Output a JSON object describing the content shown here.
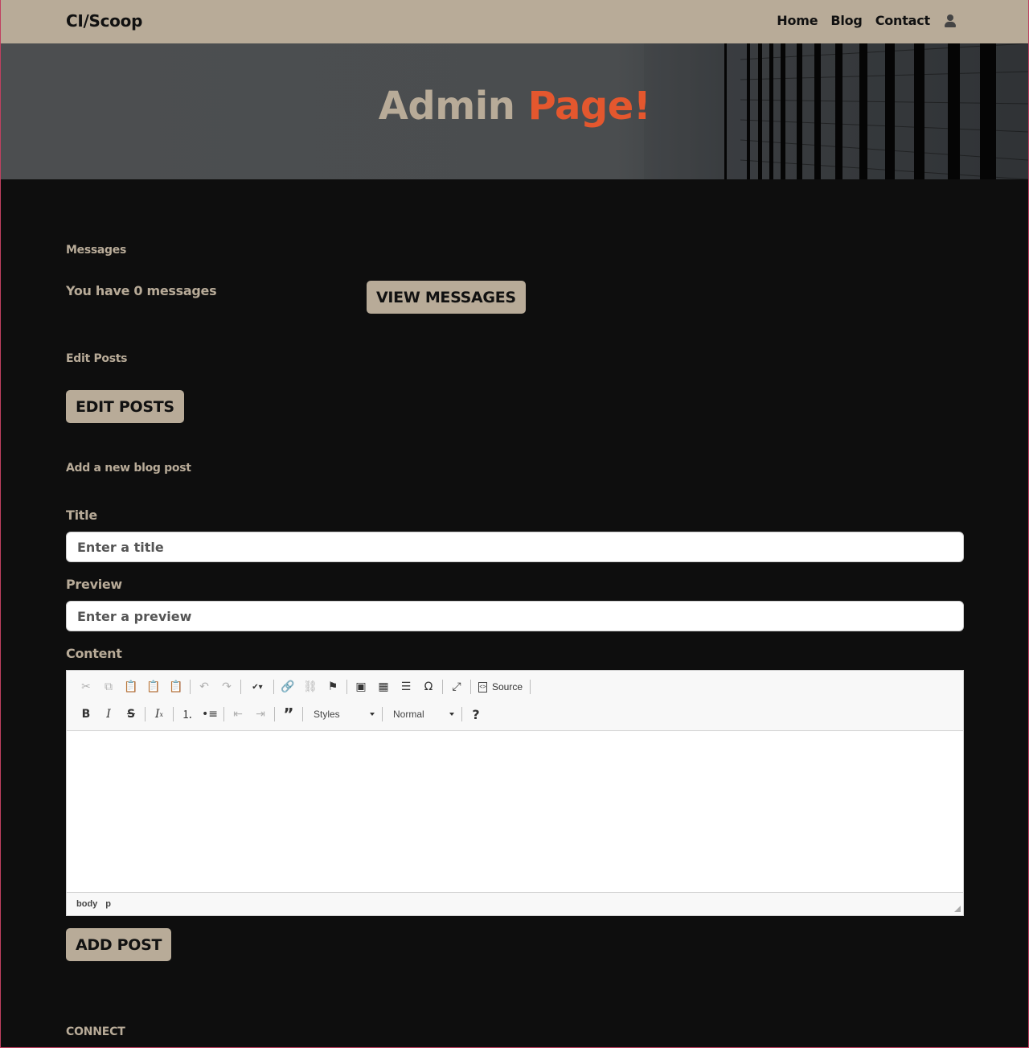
{
  "navbar": {
    "brand": "CI/Scoop",
    "links": [
      "Home",
      "Blog",
      "Contact"
    ],
    "user_icon": "user-icon"
  },
  "hero": {
    "title_part1": "Admin",
    "title_part2": "Page!"
  },
  "messages": {
    "section_label": "Messages",
    "count_text": "You have 0 messages",
    "view_button": "VIEW MESSAGES"
  },
  "edit_posts": {
    "section_label": "Edit Posts",
    "button": "EDIT POSTS"
  },
  "new_post": {
    "section_label": "Add a new blog post",
    "title_label": "Title",
    "title_placeholder": "Enter a title",
    "title_value": "",
    "preview_label": "Preview",
    "preview_placeholder": "Enter a preview",
    "preview_value": "",
    "content_label": "Content",
    "submit_button": "ADD POST"
  },
  "editor": {
    "toolbar_row1": [
      "cut-icon",
      "copy-icon",
      "paste-icon",
      "paste-text-icon",
      "paste-word-icon",
      "undo-icon",
      "redo-icon",
      "spellcheck-icon",
      "link-icon",
      "unlink-icon",
      "anchor-icon",
      "image-icon",
      "table-icon",
      "horizontal-rule-icon",
      "special-char-icon",
      "maximize-icon"
    ],
    "source_label": "Source",
    "styles_label": "Styles",
    "format_label": "Normal",
    "path": [
      "body",
      "p"
    ]
  },
  "footer": {
    "connect_label": "CONNECT"
  },
  "colors": {
    "accent": "#b8ab98",
    "highlight": "#e4572e",
    "background": "#0e0e0e"
  }
}
